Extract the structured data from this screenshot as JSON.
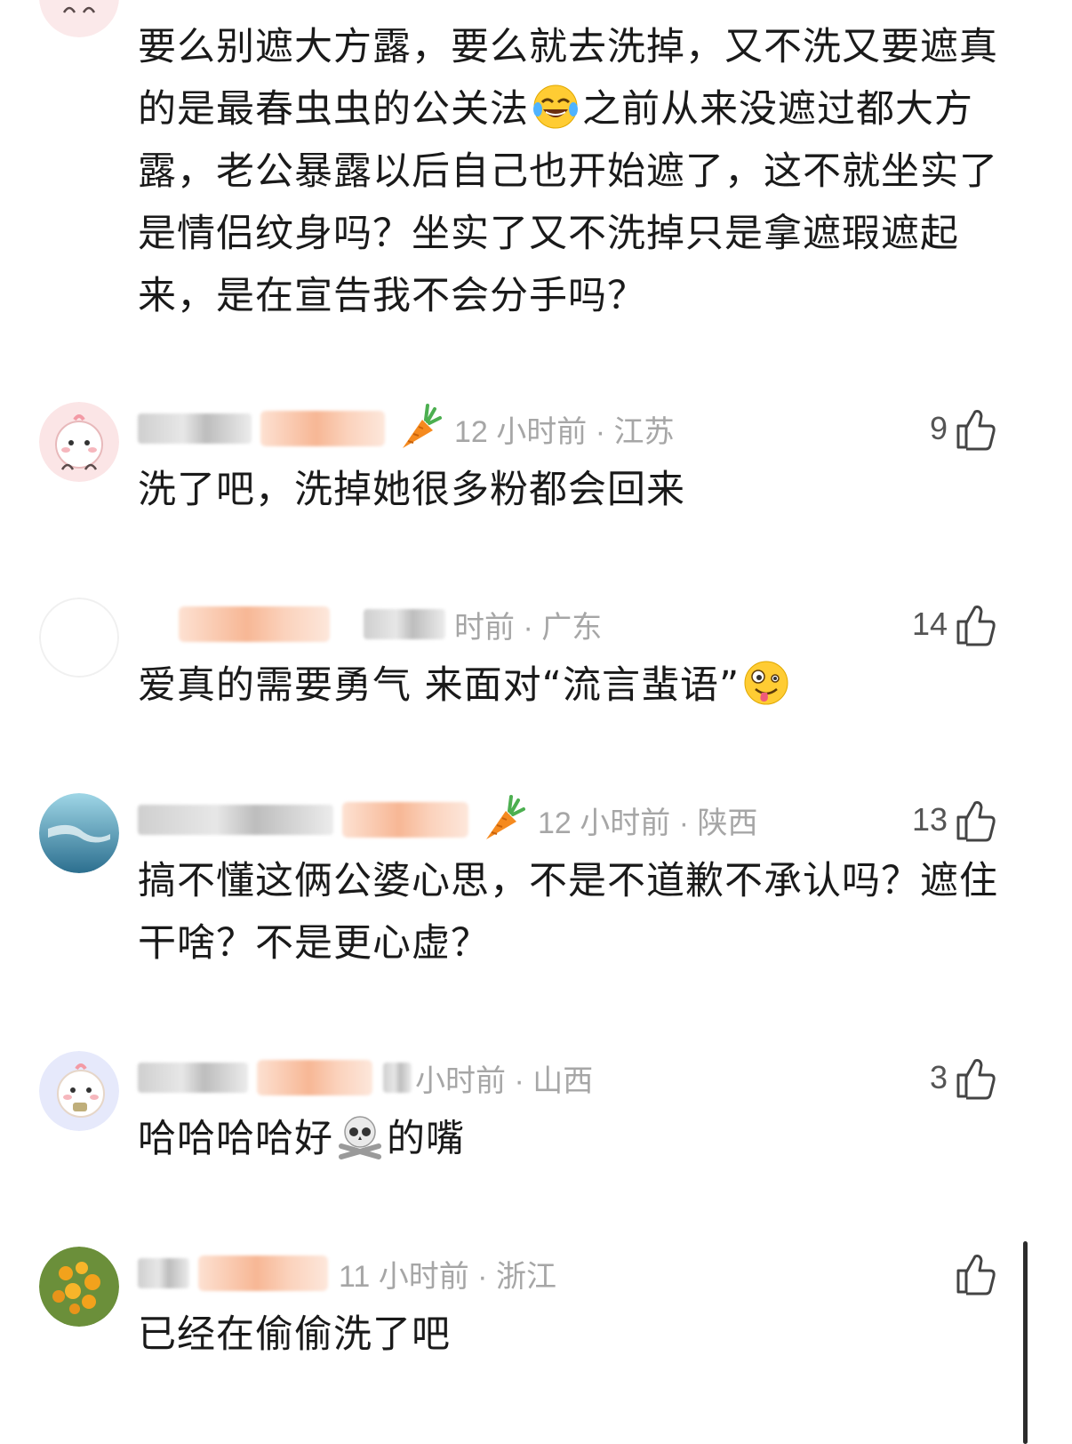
{
  "comments": [
    {
      "body": "要么别遮大方露，要么就去洗掉，又不洗又要遮真的是最春虫虫的公关法😂之前从来没遮过都大方露，老公暴露以后自己也开始遮了，这不就坐实了是情侣纹身吗？坐实了又不洗掉只是拿遮瑕遮起来，是在宣告我不会分手吗？",
      "body_before_emoji": "要么别遮大方露，要么就去洗掉，又不洗又要遮真的是最春虫虫的公关法",
      "emoji": "tears-of-joy",
      "body_after_emoji": "之前从来没遮过都大方露，老公暴露以后自己也开始遮了，这不就坐实了是情侣纹身吗？坐实了又不洗掉只是拿遮瑕遮起来，是在宣告我不会分手吗？"
    },
    {
      "meta": "12 小时前 · 江苏",
      "likes": "9",
      "body": "洗了吧，洗掉她很多粉都会回来"
    },
    {
      "meta": "时前 · 广东",
      "likes": "14",
      "body": "爱真的需要勇气 来面对“流言蜚语”"
    },
    {
      "meta": "12 小时前 · 陕西",
      "likes": "13",
      "body": "搞不懂这俩公婆心思，不是不道歉不承认吗？遮住干啥？不是更心虚？"
    },
    {
      "meta": "小时前 · 山西",
      "likes": "3",
      "body_before_emoji": "哈哈哈哈好",
      "emoji": "skull-crossbones",
      "body_after_emoji": "的嘴"
    },
    {
      "meta": "11 小时前 · 浙江",
      "likes": "",
      "body": "已经在偷偷洗了吧"
    }
  ],
  "icons": {
    "like": "thumbs-up-icon",
    "badge_carrot": "carrot-icon"
  },
  "colors": {
    "meta_gray": "#a6a6a6",
    "text": "#1a1a1a",
    "badge_orange": "#f7b795"
  }
}
